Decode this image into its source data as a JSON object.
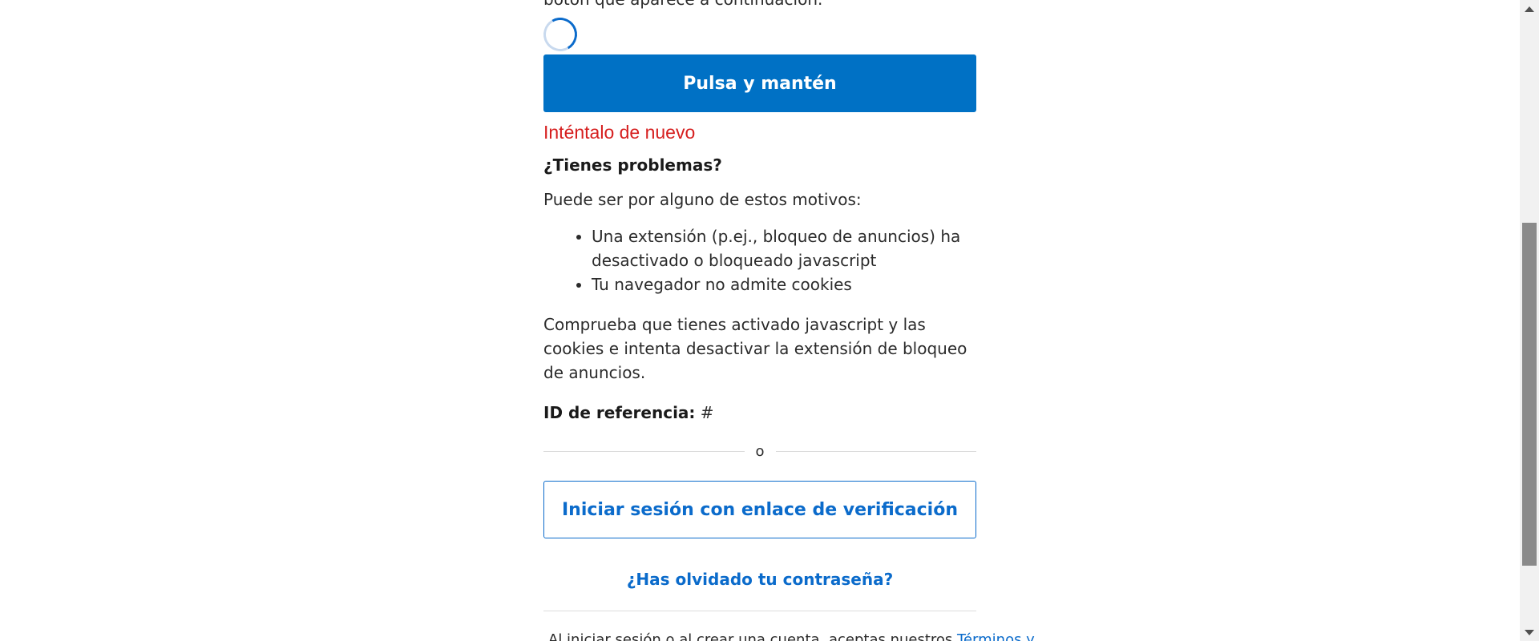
{
  "intro": {
    "text_tail": "botón que aparece a continuación."
  },
  "hold_button": {
    "label": "Pulsa y mantén"
  },
  "error": {
    "text": "Inténtalo de nuevo"
  },
  "trouble": {
    "heading": "¿Tienes problemas?",
    "reasons_intro": "Puede ser por alguno de estos motivos:",
    "reasons": [
      "Una extensión (p.ej., bloqueo de anuncios) ha desactivado o bloqueado javascript",
      "Tu navegador no admite cookies"
    ],
    "check_text": "Comprueba que tienes activado javascript y las cookies e intenta desactivar la extensión de bloqueo de anuncios."
  },
  "reference": {
    "label": "ID de referencia:",
    "value": "#"
  },
  "divider": {
    "text": "o"
  },
  "verify_button": {
    "label": "Iniciar sesión con enlace de verificación"
  },
  "forgot_link": {
    "label": "¿Has olvidado tu contraseña?"
  },
  "terms": {
    "text": "Al iniciar sesión o al crear una cuenta, aceptas nuestros ",
    "link_label": "Términos y"
  },
  "colors": {
    "primary": "#0071c5",
    "link": "#0b6bcb",
    "error": "#d61f1f"
  }
}
